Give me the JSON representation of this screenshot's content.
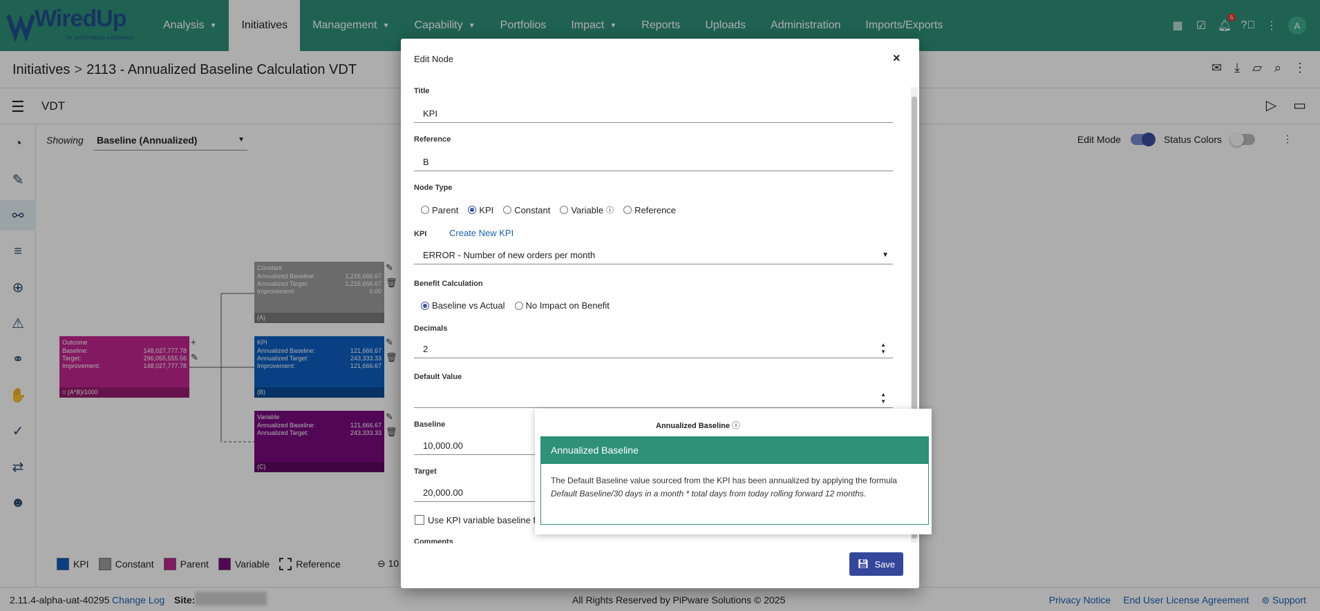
{
  "app": {
    "logo_text": "WiredUp",
    "logo_sub": "for performance excellence"
  },
  "nav": [
    {
      "label": "Analysis",
      "caret": true
    },
    {
      "label": "Initiatives",
      "caret": false
    },
    {
      "label": "Management",
      "caret": true
    },
    {
      "label": "Capability",
      "caret": true
    },
    {
      "label": "Portfolios",
      "caret": false
    },
    {
      "label": "Impact",
      "caret": true
    },
    {
      "label": "Reports",
      "caret": false
    },
    {
      "label": "Uploads",
      "caret": false
    },
    {
      "label": "Administration",
      "caret": false
    },
    {
      "label": "Imports/Exports",
      "caret": false
    }
  ],
  "notif_count": "6",
  "avatar": "A",
  "breadcrumb": {
    "root": "Initiatives",
    "sep": ">",
    "current": "2113 - Annualized Baseline Calculation VDT"
  },
  "vdt": {
    "title": "VDT"
  },
  "showing": {
    "label": "Showing",
    "value": "Baseline (Annualized)"
  },
  "controls": {
    "edit_mode": "Edit Mode",
    "status_colors": "Status Colors"
  },
  "nodes": {
    "outcome": {
      "title": "Outcome",
      "rows": [
        [
          "Baseline:",
          "148,027,777.78"
        ],
        [
          "Target:",
          "296,055,555.56"
        ],
        [
          "Improvement:",
          "148,027,777.78"
        ]
      ],
      "foot": "= (A*B)/1000",
      "color": "#c2268f"
    },
    "constant": {
      "title": "Constant",
      "rows": [
        [
          "Annualized Baseline:",
          "1,216,666.67"
        ],
        [
          "Annualized Target:",
          "1,216,666.67"
        ],
        [
          "Improvement:",
          "0.00"
        ]
      ],
      "foot": "(A)",
      "color": "#9e9e9e"
    },
    "kpi": {
      "title": "KPI",
      "rows": [
        [
          "Annualized Baseline:",
          "121,666.67"
        ],
        [
          "Annualized Target:",
          "243,333.33"
        ],
        [
          "Improvement:",
          "121,666.67"
        ]
      ],
      "foot": "(B)",
      "color": "#0d5fc2"
    },
    "variable": {
      "title": "Variable",
      "rows": [
        [
          "Annualized Baseline:",
          "121,666.67"
        ],
        [
          "Annualized Target:",
          "243,333.33"
        ]
      ],
      "foot": "(C)",
      "color": "#7a0a7f"
    }
  },
  "legend": [
    {
      "label": "KPI",
      "color": "#0d5fc2"
    },
    {
      "label": "Constant",
      "color": "#9e9e9e"
    },
    {
      "label": "Parent",
      "color": "#c2268f"
    },
    {
      "label": "Variable",
      "color": "#7a0a7f"
    },
    {
      "label": "Reference",
      "color": "#ffffff"
    }
  ],
  "zoom": "10",
  "footer": {
    "version": "2.11.4-alpha-uat-40295",
    "changelog": "Change Log",
    "site_label": "Site:",
    "copyright": "All Rights Reserved by PiPware Solutions © 2025",
    "privacy": "Privacy Notice",
    "eula": "End User License Agreement",
    "support": "Support"
  },
  "modal": {
    "title": "Edit Node",
    "close": "×",
    "title_label": "Title",
    "title_value": "KPI",
    "reference_label": "Reference",
    "reference_value": "B",
    "node_type_label": "Node Type",
    "node_types": [
      "Parent",
      "KPI",
      "Constant",
      "Variable",
      "Reference"
    ],
    "node_type_selected": "KPI",
    "kpi_label": "KPI",
    "create_kpi": "Create New KPI",
    "kpi_value": "ERROR - Number of new orders per month",
    "benefit_label": "Benefit Calculation",
    "benefit_options": [
      "Baseline vs Actual",
      "No Impact on Benefit"
    ],
    "benefit_selected": "Baseline vs Actual",
    "decimals_label": "Decimals",
    "decimals_value": "2",
    "default_label": "Default Value",
    "default_value": "",
    "baseline_label": "Baseline",
    "baseline_value": "10,000.00",
    "target_label": "Target",
    "target_value": "20,000.00",
    "checkbox_label": "Use KPI variable baseline fo",
    "comments_label": "Comments",
    "save": "Save"
  },
  "tooltip": {
    "head": "Annualized Baseline",
    "title": "Annualized Baseline",
    "body_plain": "The Default Baseline value sourced from the KPI has been annualized by applying the formula ",
    "body_italic": "Default Baseline/30 days in a month * total days from today rolling forward 12 months."
  }
}
